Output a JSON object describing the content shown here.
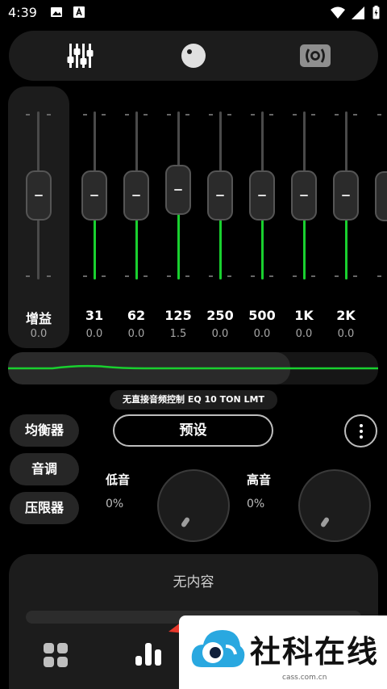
{
  "status_bar": {
    "time": "4:39"
  },
  "top_tabs": [
    {
      "name": "equalizer-sliders-icon"
    },
    {
      "name": "knob-icon"
    },
    {
      "name": "surround-icon"
    }
  ],
  "gain": {
    "label": "增益",
    "value": "0.0",
    "db": 0.0
  },
  "bands": [
    {
      "freq": "31",
      "value": "0.0",
      "db": 0.0
    },
    {
      "freq": "62",
      "value": "0.0",
      "db": 0.0
    },
    {
      "freq": "125",
      "value": "1.5",
      "db": 1.5
    },
    {
      "freq": "250",
      "value": "0.0",
      "db": 0.0
    },
    {
      "freq": "500",
      "value": "0.0",
      "db": 0.0
    },
    {
      "freq": "1K",
      "value": "0.0",
      "db": 0.0
    },
    {
      "freq": "2K",
      "value": "0.0",
      "db": 0.0
    }
  ],
  "device_label": "无直接音频控制 EQ 10 TON LMT",
  "modes": {
    "equalizer": "均衡器",
    "tone": "音调",
    "limiter": "压限器"
  },
  "preset_label": "预设",
  "bass": {
    "label": "低音",
    "value": "0%"
  },
  "treble": {
    "label": "高音",
    "value": "0%"
  },
  "player": {
    "empty_text": "无内容"
  },
  "watermark": {
    "text": "社科在线",
    "url": "cass.com.cn"
  },
  "colors": {
    "accent": "#19d02f",
    "annotation_arrow": "#e8392c"
  }
}
